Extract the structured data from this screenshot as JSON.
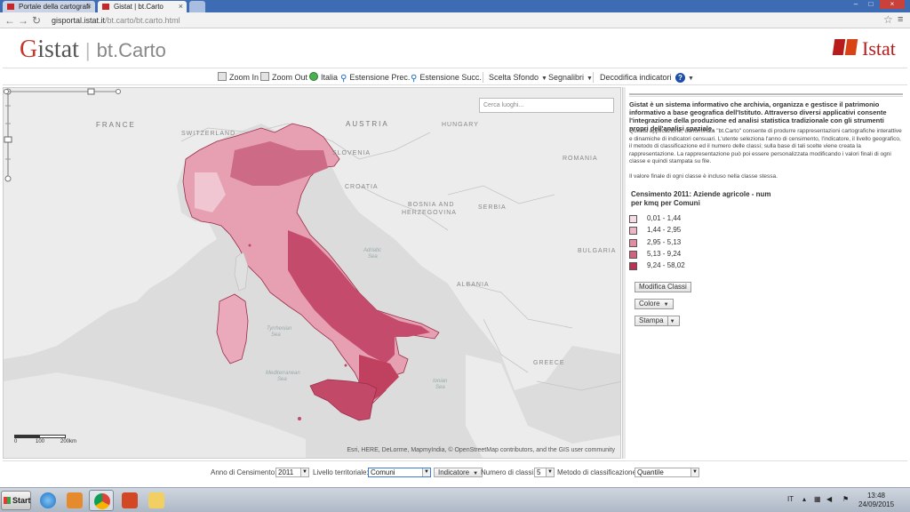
{
  "browser": {
    "tabs": [
      {
        "label": "Portale della cartografi"
      },
      {
        "label": "Gistat | bt.Carto"
      }
    ],
    "url_host": "gisportal.istat.it",
    "url_path": "/bt.carto/bt.carto.html"
  },
  "header": {
    "logo_g": "G",
    "logo_istat": "istat",
    "logo_sep": "|",
    "logo_product": "bt.Carto",
    "brand": "Istat"
  },
  "toolbar": {
    "zoom_in": "Zoom In",
    "zoom_out": "Zoom Out",
    "italia": "Italia",
    "estensione_prec": "Estensione Prec.",
    "estensione_succ": "Estensione Succ.",
    "scelta_sfondo": "Scelta Sfondo",
    "segnalibri": "Segnalibri",
    "decodifica": "Decodifica indicatori",
    "help": "?"
  },
  "map": {
    "search_placeholder": "Cerca luoghi...",
    "labels": {
      "france": "FRANCE",
      "switzerland": "SWITZERLAND",
      "austria": "AUSTRIA",
      "slovenia": "SLOVENIA",
      "hungary": "HUNGARY",
      "croatia": "CROATIA",
      "bosnia": "BOSNIA AND",
      "herzegovina": "HERZEGOVINA",
      "serbia": "SERBIA",
      "romania": "ROMANIA",
      "bulgaria": "BULGARIA",
      "albania": "ALBANIA",
      "greece": "GREECE",
      "adriatic": "Adriatic",
      "adriatic2": "Sea",
      "tyrrhenian": "Tyrrhenian",
      "tyrrhenian2": "Sea",
      "ionian": "Ionian",
      "ionian2": "Sea",
      "mediterranean": "Mediterranean",
      "mediterranean2": "Sea"
    },
    "scale_0": "0",
    "scale_100": "100",
    "scale_200": "200km",
    "attribution": "Esri, HERE, DeLorme, MapmyIndia, © OpenStreetMap contributors, and the GIS user community"
  },
  "panel": {
    "intro": "Gistat è un sistema informativo che archivia, organizza e gestisce il patrimonio informativo a base geografica dell'Istituto. Attraverso diversi applicativi consente l'integrazione della produzione ed analisi statistica tradizionale con gli strumenti propri dell'analisi spaziale.",
    "description": "Questa applicazione, denominata \"bt.Carto\" consente di produrre rappresentazioni cartografiche interattive e dinamiche di indicatori censuari. L'utente seleziona l'anno di censimento, l'indicatore, il livello geografico, il metodo di classificazione ed il numero delle classi; sulla base di tali scelte viene creata la rappresentazione. La rappresentazione può poi essere personalizzata modificando i valori finali di ogni classe e quindi stampata su file.",
    "note": "Il valore finale di ogni classe è incluso nella classe stessa.",
    "legend_title": "Censimento 2011: Aziende agricole - num per kmq per Comuni",
    "legend": [
      {
        "label": "0,01 - 1,44",
        "color": "#f6dde3"
      },
      {
        "label": "1,44 - 2,95",
        "color": "#eeb6c4"
      },
      {
        "label": "2,95 - 5,13",
        "color": "#e28ba1"
      },
      {
        "label": "5,13 - 9,24",
        "color": "#d3607d"
      },
      {
        "label": "9,24 - 58,02",
        "color": "#b83456"
      }
    ],
    "btn_modifica": "Modifica Classi",
    "btn_colore": "Colore",
    "btn_stampa": "Stampa"
  },
  "bottom": {
    "anno_label": "Anno di Censimento:",
    "anno_value": "2011",
    "livello_label": "Livello territoriale:",
    "livello_value": "Comuni",
    "indicatore": "Indicatore",
    "numero_label": "Numero di classi:",
    "numero_value": "5",
    "metodo_label": "Metodo di classificazione:",
    "metodo_value": "Quantile"
  },
  "taskbar": {
    "start": "Start",
    "lang": "IT",
    "time": "13:48",
    "date": "24/09/2015"
  }
}
